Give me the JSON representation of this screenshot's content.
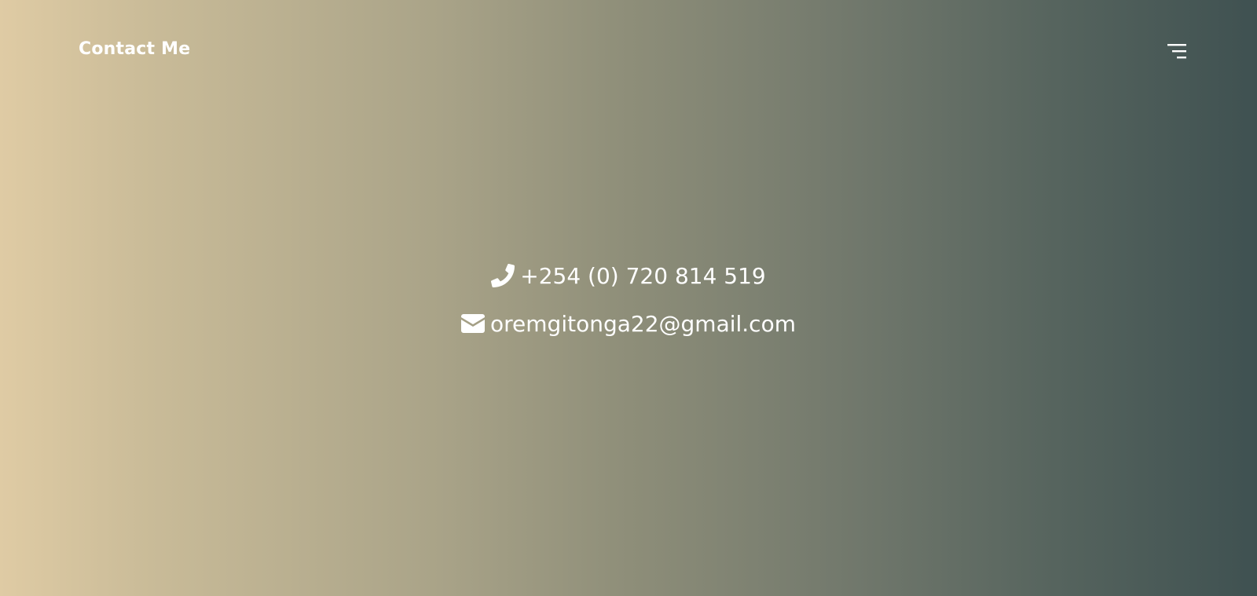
{
  "header": {
    "title": "Contact Me",
    "menu_icon": "hamburger-menu-icon"
  },
  "contact": {
    "phone": {
      "icon": "phone-icon",
      "text": "+254 (0) 720 814 519"
    },
    "email": {
      "icon": "envelope-icon",
      "text": "oremgitonga22@gmail.com"
    }
  },
  "colors": {
    "gradient_start": "#dfcba4",
    "gradient_end": "#3f5151",
    "text": "#ffffff"
  }
}
